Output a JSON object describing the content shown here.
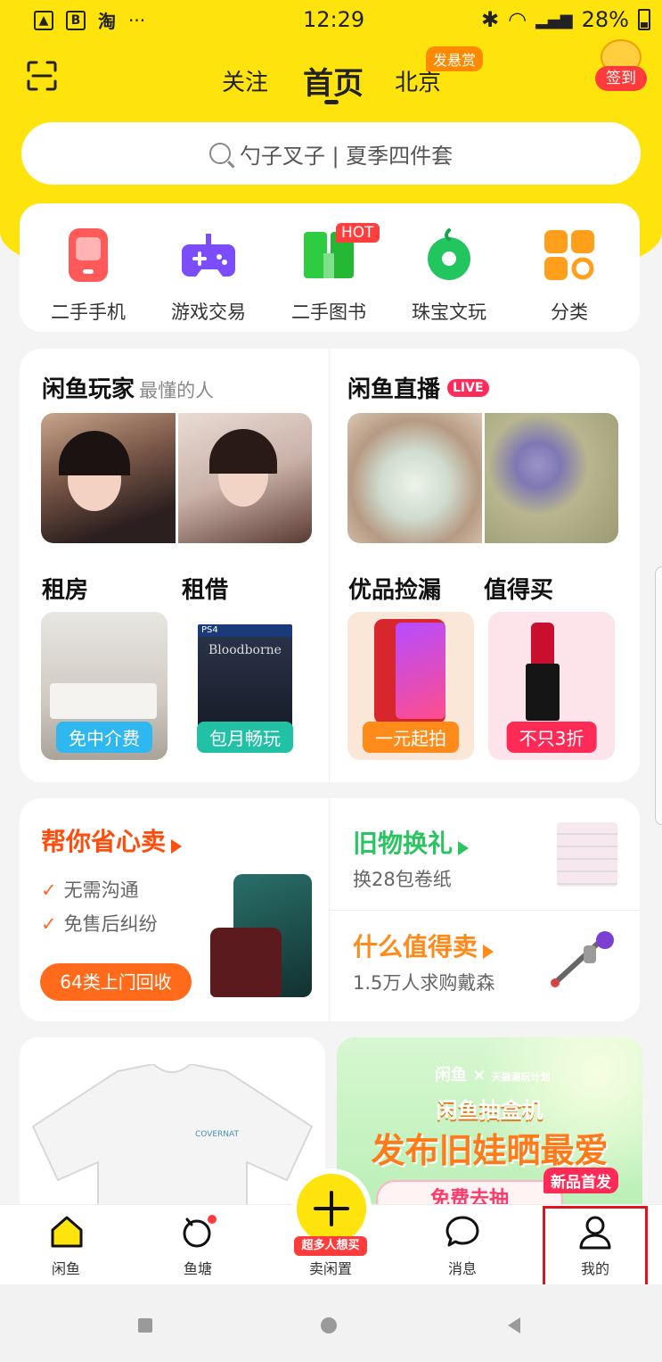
{
  "status_bar": {
    "time": "12:29",
    "battery": "28%",
    "app_icons": [
      "B",
      "淘",
      "···"
    ]
  },
  "header": {
    "tabs": [
      {
        "label": "关注"
      },
      {
        "label": "首页"
      },
      {
        "label": "北京"
      }
    ],
    "reward_badge": "发悬赏",
    "checkin_label": "签到"
  },
  "search": {
    "placeholder": "勺子叉子 | 夏季四件套"
  },
  "categories": [
    {
      "label": "二手手机",
      "icon": "phone-icon"
    },
    {
      "label": "游戏交易",
      "icon": "gamepad-icon"
    },
    {
      "label": "二手图书",
      "icon": "book-icon",
      "badge": "HOT"
    },
    {
      "label": "珠宝文玩",
      "icon": "jade-icon"
    },
    {
      "label": "分类",
      "icon": "grid-icon"
    }
  ],
  "sections": {
    "players": {
      "title": "闲鱼玩家",
      "subtitle": "最懂的人"
    },
    "live": {
      "title": "闲鱼直播",
      "badge": "LIVE"
    },
    "rent": {
      "title": "租房",
      "tag": "免中介费"
    },
    "lend": {
      "title": "租借",
      "tag": "包月畅玩",
      "game_platform": "PS4",
      "game_title": "Bloodborne"
    },
    "deals": {
      "title": "优品捡漏",
      "tag": "一元起拍"
    },
    "worth": {
      "title": "值得买",
      "tag": "不只3折"
    }
  },
  "sell_helper": {
    "title": "帮你省心卖",
    "points": [
      "无需沟通",
      "免售后纠纷"
    ],
    "button": "64类上门回收"
  },
  "exchange": {
    "title": "旧物换礼",
    "subtitle": "换28包卷纸"
  },
  "worth_selling": {
    "title": "什么值得卖",
    "subtitle": "1.5万人求购戴森"
  },
  "feed": {
    "shirt_brand": "COVERNAT",
    "promo": {
      "brand": "闲鱼",
      "partner": "天猫潮玩计划",
      "line1": "闲鱼抽盒机",
      "line2": "发布旧娃晒最爱",
      "cta": "免费去抽",
      "badge": "新品首发"
    }
  },
  "tabbar": {
    "items": [
      {
        "label": "闲鱼"
      },
      {
        "label": "鱼塘"
      },
      {
        "label": "卖闲置",
        "tag": "超多人想买"
      },
      {
        "label": "消息"
      },
      {
        "label": "我的"
      }
    ]
  },
  "colors": {
    "brand_yellow": "#ffe30c",
    "accent_orange": "#ff4d0d",
    "green": "#2bc462",
    "highlight_red": "#e0141e"
  }
}
